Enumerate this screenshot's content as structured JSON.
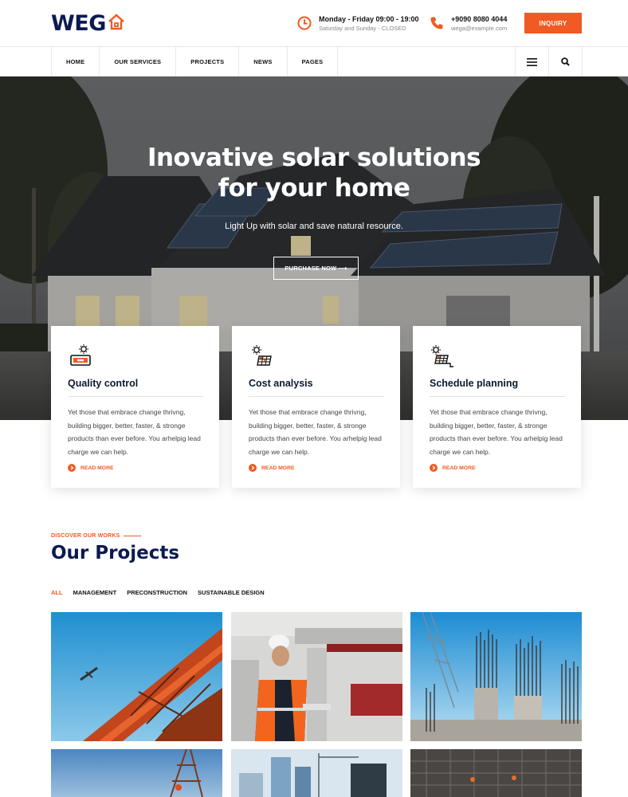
{
  "header": {
    "logo": "WEG",
    "hours_title": "Monday - Friday 09:00 - 19:00",
    "hours_sub": "Saturday and Sunday - CLOSED",
    "phone": "+9090 8080 4044",
    "email": "wega@example.com",
    "inquiry_label": "INQUIRY"
  },
  "nav": {
    "items": [
      "HOME",
      "OUR SERVICES",
      "PROJECTS",
      "NEWS",
      "PAGES"
    ]
  },
  "hero": {
    "title_line1": "Inovative solar solutions",
    "title_line2": "for your home",
    "subtitle": "Light Up with solar and save natural resource.",
    "cta": "PURCHASE NOW ⟶"
  },
  "features": [
    {
      "title": "Quality control",
      "icon": "solar-battery-icon",
      "text": "Yet those that embrace change thrivng, building bigger, better, faster, & stronge products than ever before. You arhelpig lead charge we can help.",
      "link": "READ MORE"
    },
    {
      "title": "Cost analysis",
      "icon": "solar-panel-icon",
      "text": "Yet those that embrace change thrivng, building bigger, better, faster, & stronge products than ever before. You arhelpig lead charge we can help.",
      "link": "READ MORE"
    },
    {
      "title": "Schedule planning",
      "icon": "solar-panel-plug-icon",
      "text": "Yet those that embrace change thrivng, building bigger, better, faster, & stronge products than ever before. You arhelpig lead charge we can help.",
      "link": "READ MORE"
    }
  ],
  "projects": {
    "kicker": "DISCOVER OUR WORKS",
    "title": "Our Projects",
    "filters": [
      "ALL",
      "MANAGEMENT",
      "PRECONSTRUCTION",
      "SUSTAINABLE DESIGN"
    ],
    "active_filter": "ALL"
  },
  "colors": {
    "accent": "#f15a22",
    "navy": "#0b1a4f"
  }
}
